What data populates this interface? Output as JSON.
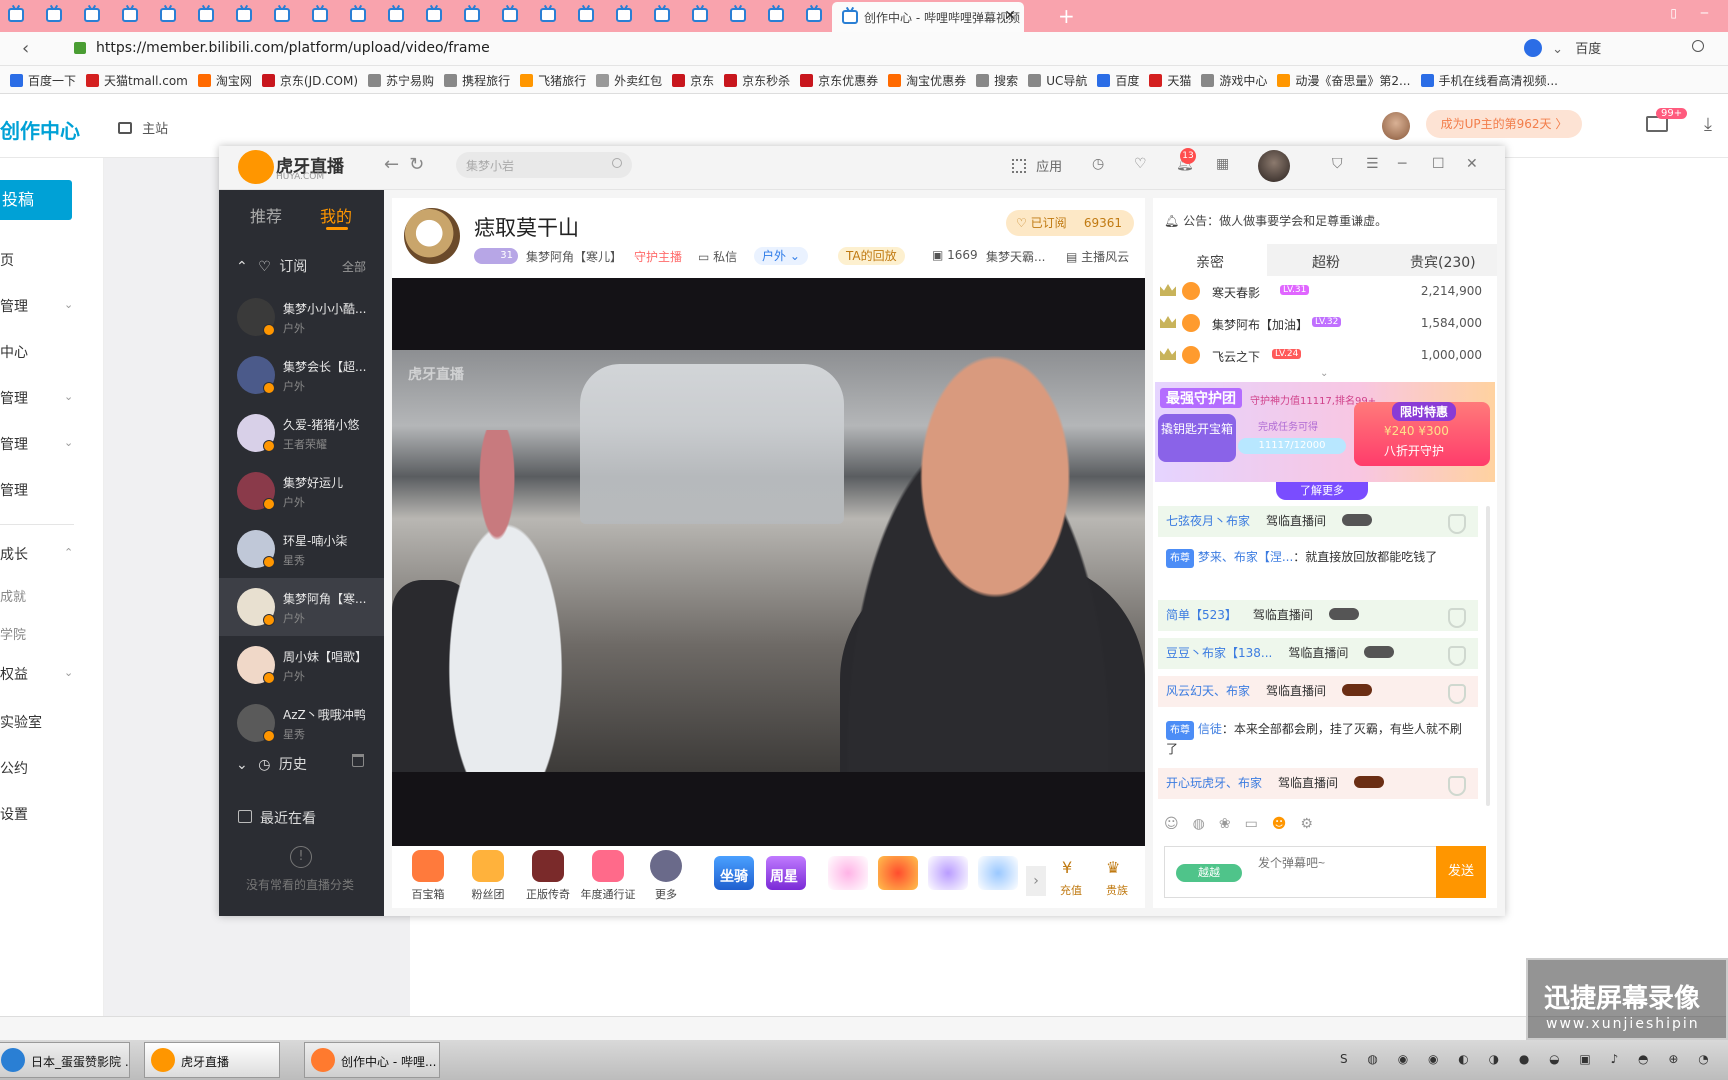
{
  "browser": {
    "active_tab_title": "创作中心 - 哔哩哔哩弹幕视频",
    "url": "https://member.bilibili.com/platform/upload/video/frame",
    "search_engine": "百度",
    "bookmarks": [
      "百度一下",
      "天猫tmall.com",
      "淘宝网",
      "京东(JD.COM)",
      "苏宁易购",
      "携程旅行",
      "飞猪旅行",
      "外卖红包",
      "京东",
      "京东秒杀",
      "京东优惠券",
      "淘宝优惠券",
      "搜索",
      "UC导航",
      "百度",
      "天猫",
      "游戏中心",
      "动漫《奋思量》第2...",
      "手机在线看高清视频..."
    ]
  },
  "bilibili": {
    "logo": "创作中心",
    "home": "主站",
    "up_days": "成为UP主的第962天 〉",
    "msg_badge": "99+",
    "upload_btn": "投稿",
    "nav": [
      "页",
      "管理",
      "中心",
      "管理",
      "管理",
      "管理",
      "成长",
      "成就",
      "学院",
      "权益",
      "实验室",
      "公约",
      "设置"
    ]
  },
  "huya": {
    "logo": "虎牙直播",
    "logo_sub": "HUYA.COM",
    "search_placeholder": "集梦小岩",
    "apps": "应用",
    "notif_count": "13",
    "tabs": {
      "recommend": "推荐",
      "mine": "我的"
    },
    "subs_title": "订阅",
    "subs_all": "全部",
    "subscriptions": [
      {
        "name": "集梦小小小酷...",
        "cat": "户外",
        "color": "#3a3a3a"
      },
      {
        "name": "集梦会长【超...",
        "cat": "户外",
        "color": "#4b5a8a"
      },
      {
        "name": "久爱-猪猪小悠",
        "cat": "王者荣耀",
        "color": "#d8d0e8"
      },
      {
        "name": "集梦好运儿",
        "cat": "户外",
        "color": "#8a3a4a"
      },
      {
        "name": "环星-喃小柒",
        "cat": "星秀",
        "color": "#c0c8d8"
      },
      {
        "name": "集梦阿角【寒...",
        "cat": "户外",
        "color": "#e8e0d0"
      },
      {
        "name": "周小妹【唱歌】",
        "cat": "户外",
        "color": "#f0d8c8"
      },
      {
        "name": "AzZ丶哦哦冲鸭",
        "cat": "星秀",
        "color": "#5a5a5a"
      }
    ],
    "history": "历史",
    "recent": "最近在看",
    "no_category": "没有常看的直播分类",
    "room": {
      "title": "痣取莫干山",
      "level": "31",
      "streamer": "集梦阿角【寒儿】",
      "guard": "守护主播",
      "message": "私信",
      "category": "户外",
      "replay": "TA的回放",
      "viewers": "1669",
      "group": "集梦天霸...",
      "style": "主播风云",
      "subscribed": "已订阅",
      "subscriber_count": "69361",
      "watermark": "虎牙直播"
    },
    "gifts": [
      {
        "label": "百宝箱",
        "color": "#ff7a3c"
      },
      {
        "label": "粉丝团",
        "color": "#ffb23c"
      },
      {
        "label": "正版传奇",
        "color": "#7a2a2a"
      },
      {
        "label": "年度通行证",
        "color": "#ff6a8a"
      },
      {
        "label": "更多",
        "color": "#6a6a8a"
      }
    ],
    "gift_text": [
      "坐骑",
      "周星"
    ],
    "recharge": "充值",
    "noble": "贵族",
    "notice": "公告：做人做事要学会和足尊重谦虚。",
    "rank_tabs": [
      "亲密",
      "超粉",
      "贵宾(230)"
    ],
    "ranks": [
      {
        "name": "寒天春影",
        "lv": "LV.31",
        "value": "2,214,900"
      },
      {
        "name": "集梦阿布【加油】",
        "lv": "LV.32",
        "value": "1,584,000"
      },
      {
        "name": "飞云之下",
        "lv": "LV.24",
        "value": "1,000,000"
      }
    ],
    "guard_panel": {
      "title": "最强守护团",
      "subtitle": "守护神力值11117,排名99+",
      "box": "撬钥匙开宝箱",
      "task": "完成任务可得",
      "progress": "11117/12000",
      "limited": "限时特惠",
      "price": "¥240 ¥300",
      "cta": "八折开守护",
      "more": "了解更多"
    },
    "chat": [
      {
        "user": "七弦夜月丶布家",
        "text": "驾临直播间",
        "type": "green"
      },
      {
        "user": "梦来、布家【涅...",
        "text": "：就直接放回放都能吃钱了",
        "type": "plain",
        "badge": "布尊"
      },
      {
        "user": "简单【523】",
        "text": "驾临直播间",
        "type": "green"
      },
      {
        "user": "豆豆丶布家【138...",
        "text": "驾临直播间",
        "type": "green"
      },
      {
        "user": "风云幻天、布家",
        "text": "驾临直播间",
        "type": "red"
      },
      {
        "user": "信徒",
        "text": "：本来全部都会刷，挂了灭霸，有些人就不刷了",
        "type": "plain",
        "badge": "布尊"
      },
      {
        "user": "开心玩虎牙、布家",
        "text": "驾临直播间",
        "type": "red"
      }
    ],
    "chat_badge": "越越",
    "chat_placeholder": "发个弹幕吧~",
    "send": "发送"
  },
  "taskbar": {
    "items": [
      "日本_蛋蛋赞影院 ...",
      "虎牙直播",
      "创作中心 - 哔哩..."
    ],
    "recorder_title": "迅捷屏幕录像",
    "recorder_url": "www.xunjieshipin"
  }
}
